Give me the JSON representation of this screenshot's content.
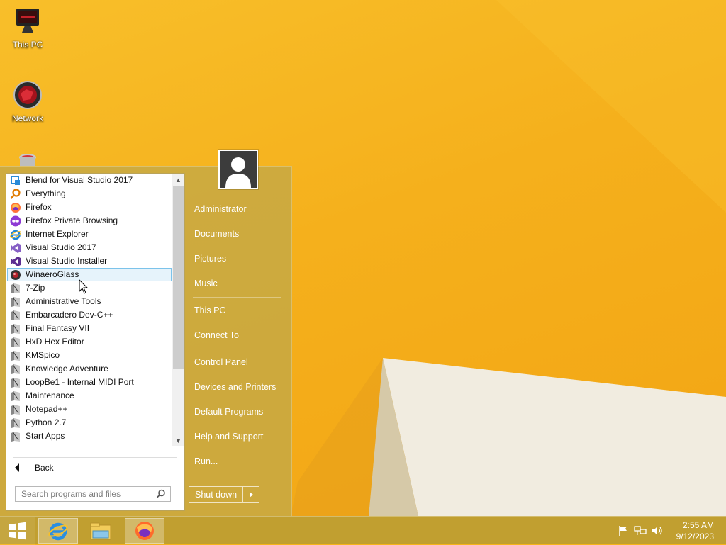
{
  "desktop": {
    "icons": [
      {
        "label": "This PC"
      },
      {
        "label": "Network"
      }
    ]
  },
  "start_menu": {
    "programs": [
      {
        "label": "Blend for Visual Studio 2017",
        "icon": "blend-icon"
      },
      {
        "label": "Everything",
        "icon": "magnifier-icon"
      },
      {
        "label": "Firefox",
        "icon": "firefox-icon"
      },
      {
        "label": "Firefox Private Browsing",
        "icon": "private-mask-icon"
      },
      {
        "label": "Internet Explorer",
        "icon": "ie-icon"
      },
      {
        "label": "Visual Studio 2017",
        "icon": "vs-icon"
      },
      {
        "label": "Visual Studio Installer",
        "icon": "vs-installer-icon"
      },
      {
        "label": "WinaeroGlass",
        "icon": "winaero-glass-icon"
      },
      {
        "label": "7-Zip",
        "icon": "folder-icon"
      },
      {
        "label": "Administrative Tools",
        "icon": "folder-icon"
      },
      {
        "label": "Embarcadero Dev-C++",
        "icon": "folder-icon"
      },
      {
        "label": "Final Fantasy VII",
        "icon": "folder-icon"
      },
      {
        "label": "HxD Hex Editor",
        "icon": "folder-icon"
      },
      {
        "label": "KMSpico",
        "icon": "folder-icon"
      },
      {
        "label": "Knowledge Adventure",
        "icon": "folder-icon"
      },
      {
        "label": "LoopBe1 - Internal MIDI Port",
        "icon": "folder-icon"
      },
      {
        "label": "Maintenance",
        "icon": "folder-icon"
      },
      {
        "label": "Notepad++",
        "icon": "folder-icon"
      },
      {
        "label": "Python 2.7",
        "icon": "folder-icon"
      },
      {
        "label": "Start Apps",
        "icon": "folder-icon"
      }
    ],
    "selected_program": "WinaeroGlass",
    "back_label": "Back",
    "search_placeholder": "Search programs and files",
    "right_items": [
      {
        "label": "Administrator"
      },
      {
        "label": "Documents"
      },
      {
        "label": "Pictures"
      },
      {
        "label": "Music"
      },
      {
        "label": "This PC"
      },
      {
        "label": "Connect To"
      },
      {
        "label": "Control Panel"
      },
      {
        "label": "Devices and Printers"
      },
      {
        "label": "Default Programs"
      },
      {
        "label": "Help and Support"
      },
      {
        "label": "Run..."
      }
    ],
    "shutdown_label": "Shut down"
  },
  "taskbar": {
    "apps": [
      {
        "name": "internet-explorer",
        "icon": "ie-icon"
      },
      {
        "name": "file-explorer",
        "icon": "file-explorer-icon"
      },
      {
        "name": "firefox",
        "icon": "firefox-icon"
      }
    ],
    "tray_icons": [
      "flag-icon",
      "network-icon",
      "speaker-icon"
    ],
    "time": "2:55 AM",
    "date": "9/12/2023"
  },
  "colors": {
    "wallpaper": "#f6b41a",
    "menu_glass": "#c4a846",
    "selection": "#e6f3fb"
  }
}
